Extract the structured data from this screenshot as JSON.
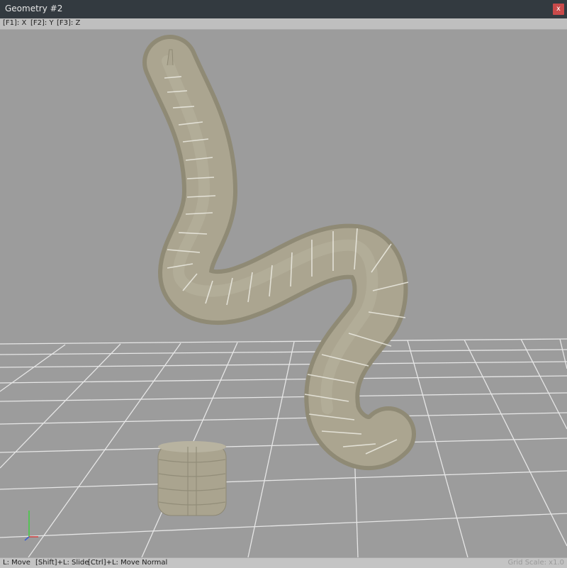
{
  "window": {
    "title": "Geometry #2",
    "close_label": "x"
  },
  "axis_shortcuts": [
    "[F1]: X",
    "[F2]: Y",
    "[F3]: Z"
  ],
  "status": {
    "hints": [
      "L: Move",
      "[Shift]+L: Slide",
      "[Ctrl]+L: Move Normal"
    ],
    "grid_scale": "Grid Scale: x1.0"
  },
  "colors": {
    "title_bg": "#333a40",
    "close_bg": "#c94a4a",
    "viewport_bg": "#9c9c9c",
    "mesh_fill": "#aba590",
    "mesh_shadow": "#8f8a75",
    "mesh_seam": "#ecebe2",
    "grid_line": "#e6e6e6"
  },
  "viewport": {
    "objects": [
      "worm-mesh",
      "cylinder-mesh"
    ],
    "gizmo": "axis-gizmo"
  }
}
